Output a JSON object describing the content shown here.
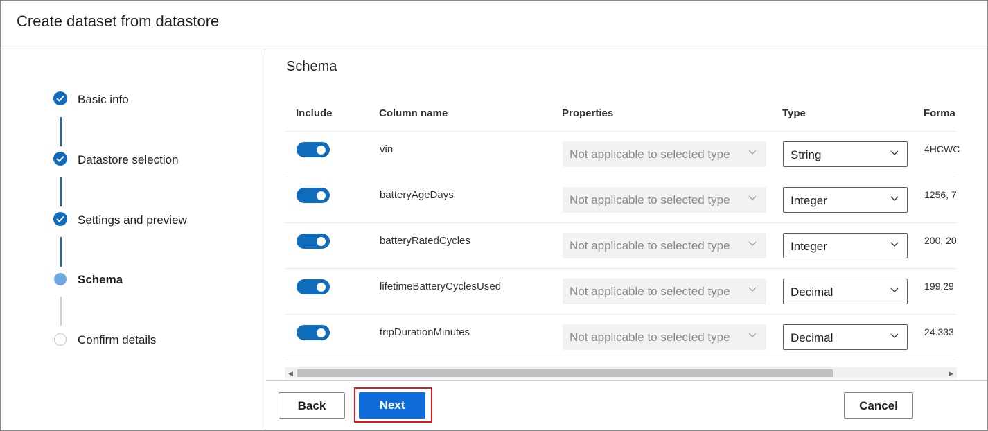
{
  "header": {
    "title": "Create dataset from datastore"
  },
  "steps": [
    {
      "label": "Basic info",
      "status": "done"
    },
    {
      "label": "Datastore selection",
      "status": "done"
    },
    {
      "label": "Settings and preview",
      "status": "done"
    },
    {
      "label": "Schema",
      "status": "current"
    },
    {
      "label": "Confirm details",
      "status": "pending"
    }
  ],
  "schema": {
    "title": "Schema",
    "columns": {
      "include": "Include",
      "column_name": "Column name",
      "properties": "Properties",
      "type": "Type",
      "format": "Forma"
    },
    "rows": [
      {
        "include": true,
        "name": "vin",
        "properties": "Not applicable to selected type",
        "type": "String",
        "format": "4HCWC"
      },
      {
        "include": true,
        "name": "batteryAgeDays",
        "properties": "Not applicable to selected type",
        "type": "Integer",
        "format": "1256, 7"
      },
      {
        "include": true,
        "name": "batteryRatedCycles",
        "properties": "Not applicable to selected type",
        "type": "Integer",
        "format": "200, 20"
      },
      {
        "include": true,
        "name": "lifetimeBatteryCyclesUsed",
        "properties": "Not applicable to selected type",
        "type": "Decimal",
        "format": "199.29"
      },
      {
        "include": true,
        "name": "tripDurationMinutes",
        "properties": "Not applicable to selected type",
        "type": "Decimal",
        "format": "24.333"
      }
    ]
  },
  "footer": {
    "back_label": "Back",
    "next_label": "Next",
    "cancel_label": "Cancel"
  },
  "colors": {
    "accent": "#0f6cbd",
    "primary_button": "#0f6cdb",
    "highlight": "#e0141e"
  }
}
